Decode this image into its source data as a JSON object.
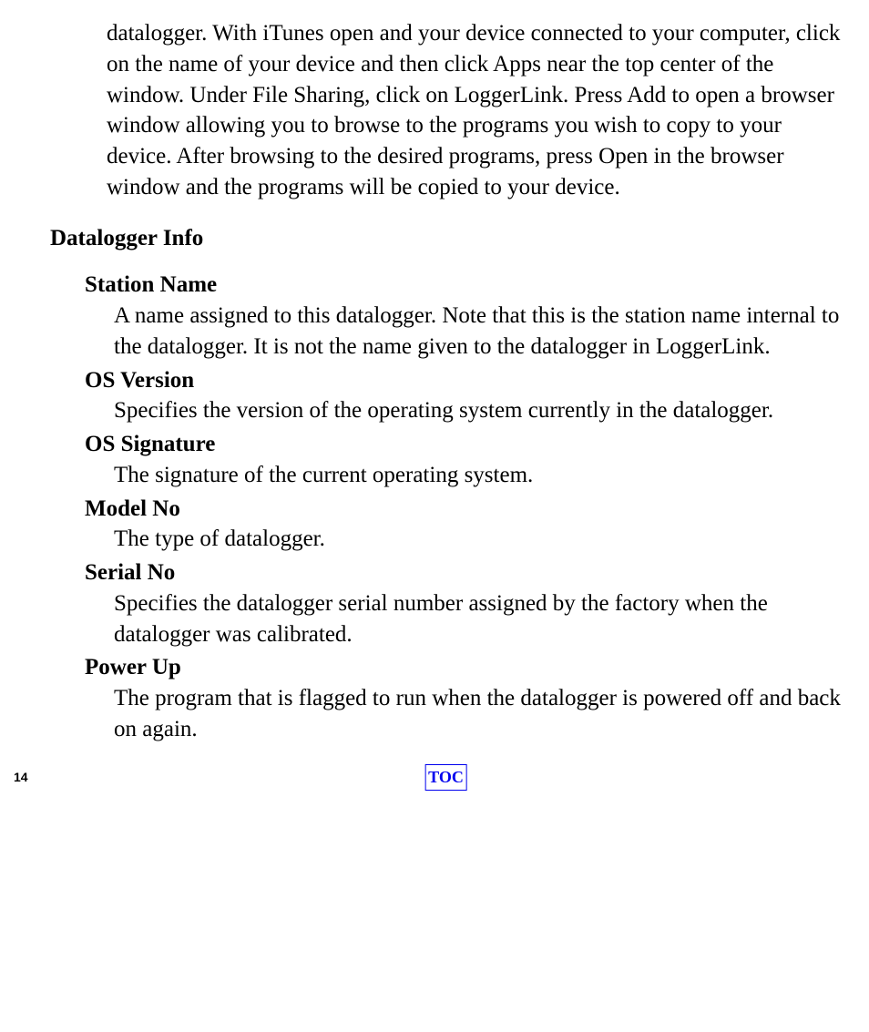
{
  "intro_paragraph": "datalogger.  With iTunes open and your device connected to your computer, click on the name of your device and then click Apps near the top center of the window.  Under File Sharing, click on LoggerLink.  Press Add to open a browser window allowing you to browse to the programs you wish to copy to your device.  After browsing to the desired programs, press Open in the browser window and the programs will be copied to your device.",
  "section_heading": "Datalogger Info",
  "terms": {
    "station_name": {
      "title": "Station Name",
      "desc": "A name assigned to this datalogger.  Note that this is the station name internal to the datalogger.  It is not the name given to the datalogger in LoggerLink."
    },
    "os_version": {
      "title": "OS Version",
      "desc": "Specifies the version of the operating system currently in the datalogger."
    },
    "os_signature": {
      "title": "OS Signature",
      "desc": "The signature of the current operating system."
    },
    "model_no": {
      "title": "Model No",
      "desc": "The type of datalogger."
    },
    "serial_no": {
      "title": "Serial No",
      "desc": "Specifies the datalogger serial number assigned by the factory when the datalogger was calibrated."
    },
    "power_up": {
      "title": "Power Up",
      "desc": "The program that is flagged to run when the datalogger is powered off and back on again."
    }
  },
  "footer": {
    "page_number": "14",
    "toc_label": "TOC"
  }
}
